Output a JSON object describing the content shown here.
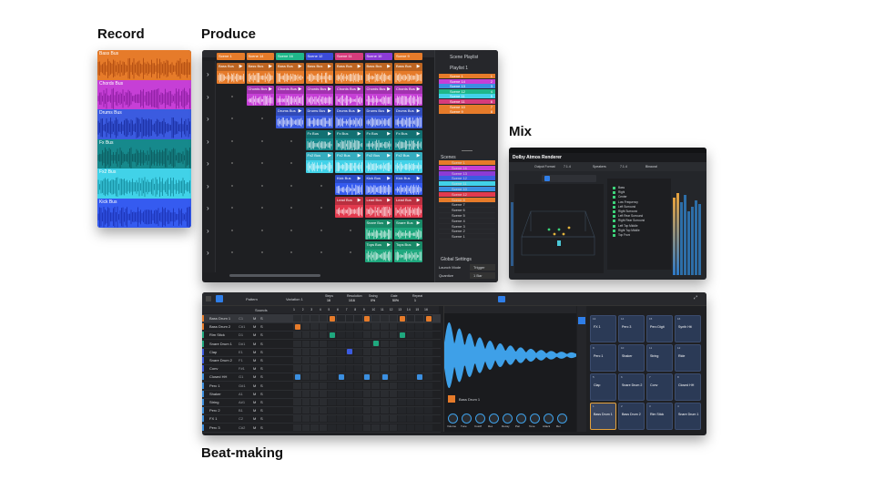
{
  "sections": {
    "record": "Record",
    "produce": "Produce",
    "mix": "Mix",
    "beat": "Beat-making"
  },
  "record": {
    "tracks": [
      {
        "name": "Bass Bus",
        "color": "#e67b2a",
        "wave": "#b24e12"
      },
      {
        "name": "Chords Bus",
        "color": "#c63fd6",
        "wave": "#8e1fa3"
      },
      {
        "name": "Drums Bus",
        "color": "#3b5be0",
        "wave": "#1b2fa2"
      },
      {
        "name": "Fx Bus",
        "color": "#16898c",
        "wave": "#0d5d60"
      },
      {
        "name": "Fx2 Bus",
        "color": "#41d2e8",
        "wave": "#178ea1"
      },
      {
        "name": "Kick Bus",
        "color": "#355bf0",
        "wave": "#1c34b6"
      }
    ]
  },
  "produce": {
    "scenes": [
      "Scene 1",
      "Scene 14",
      "Scene 16",
      "Scene 12",
      "Scene 11",
      "Scene 10",
      "Scene 9"
    ],
    "scene_colors": [
      "#e67b2a",
      "#e67b2a",
      "#1fb78a",
      "#3b4bd8",
      "#d63c7c",
      "#8c3bd6",
      "#e67b2a"
    ],
    "clips": [
      {
        "col": 0,
        "row": 0,
        "name": "Bass Bus",
        "color": "#e67b2a"
      },
      {
        "col": 1,
        "row": 0,
        "name": "Bass Bus",
        "color": "#e67b2a"
      },
      {
        "col": 2,
        "row": 0,
        "name": "Bass Bus",
        "color": "#e67b2a"
      },
      {
        "col": 3,
        "row": 0,
        "name": "Bass Bus",
        "color": "#e67b2a"
      },
      {
        "col": 4,
        "row": 0,
        "name": "Bass Bus",
        "color": "#e67b2a"
      },
      {
        "col": 5,
        "row": 0,
        "name": "Bass Bus",
        "color": "#e67b2a"
      },
      {
        "col": 6,
        "row": 0,
        "name": "Bass Bus",
        "color": "#e67b2a"
      },
      {
        "col": 1,
        "row": 1,
        "name": "Chords Bus",
        "color": "#c63fd6"
      },
      {
        "col": 2,
        "row": 1,
        "name": "Chords Bus",
        "color": "#c63fd6"
      },
      {
        "col": 3,
        "row": 1,
        "name": "Chords Bus",
        "color": "#c63fd6"
      },
      {
        "col": 4,
        "row": 1,
        "name": "Chords Bus",
        "color": "#c63fd6"
      },
      {
        "col": 5,
        "row": 1,
        "name": "Chords Bus",
        "color": "#c63fd6"
      },
      {
        "col": 6,
        "row": 1,
        "name": "Chords Bus",
        "color": "#c63fd6"
      },
      {
        "col": 2,
        "row": 2,
        "name": "Drums Bus",
        "color": "#3b5be0"
      },
      {
        "col": 3,
        "row": 2,
        "name": "Drums Bus",
        "color": "#3b5be0"
      },
      {
        "col": 4,
        "row": 2,
        "name": "Drums Bus",
        "color": "#3b5be0"
      },
      {
        "col": 5,
        "row": 2,
        "name": "Drums Bus",
        "color": "#3b5be0"
      },
      {
        "col": 6,
        "row": 2,
        "name": "Drums Bus",
        "color": "#3b5be0"
      },
      {
        "col": 3,
        "row": 3,
        "name": "Fx Bus",
        "color": "#16898c"
      },
      {
        "col": 4,
        "row": 3,
        "name": "Fx Bus",
        "color": "#16898c"
      },
      {
        "col": 5,
        "row": 3,
        "name": "Fx Bus",
        "color": "#16898c"
      },
      {
        "col": 6,
        "row": 3,
        "name": "Fx Bus",
        "color": "#16898c"
      },
      {
        "col": 3,
        "row": 4,
        "name": "Fx2 Bus",
        "color": "#41d2e8"
      },
      {
        "col": 4,
        "row": 4,
        "name": "Fx2 Bus",
        "color": "#41d2e8"
      },
      {
        "col": 5,
        "row": 4,
        "name": "Fx2 Bus",
        "color": "#41d2e8"
      },
      {
        "col": 6,
        "row": 4,
        "name": "Fx2 Bus",
        "color": "#41d2e8"
      },
      {
        "col": 4,
        "row": 5,
        "name": "Kick Bus",
        "color": "#355bf0"
      },
      {
        "col": 5,
        "row": 5,
        "name": "Kick Bus",
        "color": "#355bf0"
      },
      {
        "col": 6,
        "row": 5,
        "name": "Kick Bus",
        "color": "#355bf0"
      },
      {
        "col": 4,
        "row": 6,
        "name": "Lead Bus",
        "color": "#e23a4e"
      },
      {
        "col": 5,
        "row": 6,
        "name": "Lead Bus",
        "color": "#e23a4e"
      },
      {
        "col": 6,
        "row": 6,
        "name": "Lead Bus",
        "color": "#e23a4e"
      },
      {
        "col": 5,
        "row": 7,
        "name": "Snare Bus",
        "color": "#1fa87e"
      },
      {
        "col": 6,
        "row": 7,
        "name": "Snare Bus",
        "color": "#1fa87e"
      },
      {
        "col": 5,
        "row": 8,
        "name": "Tops Bus",
        "color": "#1fa87e"
      },
      {
        "col": 6,
        "row": 8,
        "name": "Tops Bus",
        "color": "#1fa87e"
      }
    ],
    "playlist_title": "Scene Playlist",
    "playlist_name": "Playlist 1",
    "playlist_items": [
      {
        "name": "Scene 1",
        "num": "1",
        "color": "#e67b2a"
      },
      {
        "name": "Scene 14",
        "num": "2",
        "color": "#c63fd6"
      },
      {
        "name": "Scene 13",
        "num": "3",
        "color": "#3b8fe0"
      },
      {
        "name": "Scene 12",
        "num": "4",
        "color": "#1fb78a"
      },
      {
        "name": "Scene 11",
        "num": "5",
        "color": "#41d2e8"
      },
      {
        "name": "Scene 11",
        "num": "6",
        "color": "#d63c7c"
      },
      {
        "name": "Scene 10",
        "num": "7",
        "color": "#e67b2a"
      },
      {
        "name": "Scene 9",
        "num": "8",
        "color": "#e67b2a"
      }
    ],
    "scenes_title": "Scenes",
    "scene_list": [
      {
        "name": "Scene 1",
        "color": "#e67b2a"
      },
      {
        "name": "Scene 16",
        "color": "#c63fd6"
      },
      {
        "name": "Scene 13",
        "color": "#8c3bd6"
      },
      {
        "name": "Scene 12",
        "color": "#3b5be0"
      },
      {
        "name": "Scene 11",
        "color": "#41d2e8"
      },
      {
        "name": "Scene 10",
        "color": "#3b8fe0"
      },
      {
        "name": "Scene 12",
        "color": "#e23a4e"
      },
      {
        "name": "Scene 8",
        "color": "#e67b2a"
      },
      {
        "name": "Scene 7",
        "color": ""
      },
      {
        "name": "Scene 6",
        "color": ""
      },
      {
        "name": "Scene 5",
        "color": ""
      },
      {
        "name": "Scene 4",
        "color": ""
      },
      {
        "name": "Scene 3",
        "color": ""
      },
      {
        "name": "Scene 2",
        "color": ""
      },
      {
        "name": "Scene 1",
        "color": ""
      }
    ],
    "global_settings": "Global Settings",
    "launch_mode_label": "Launch Mode",
    "launch_mode_value": "Trigger",
    "quantize_label": "Quantize",
    "quantize_value": "1 Bar"
  },
  "mix": {
    "brand": "Dolby Atmos Renderer",
    "tabs": [
      "Output Format",
      "7.1.4",
      "Speakers",
      "7.1.4",
      "Binaural"
    ],
    "object_rows": [
      "Bass",
      "Right",
      "Center",
      "Low Frequency",
      "Left Surround",
      "Right Surround",
      "Left Rear Surround",
      "Right Rear Surround",
      "Left Top Middle",
      "Right Top Middle",
      "Top Front"
    ]
  },
  "beat": {
    "pattern_label": "Pattern",
    "variation_label": "Variation 1",
    "params": [
      {
        "label": "Steps",
        "value": "16"
      },
      {
        "label": "Resolution",
        "value": "1/16"
      },
      {
        "label": "Swing",
        "value": "0%"
      },
      {
        "label": "Gate",
        "value": "50%"
      },
      {
        "label": "Repeat",
        "value": "1"
      }
    ],
    "sounds_label": "Sounds",
    "columns": [
      "1",
      "2",
      "3",
      "4",
      "5",
      "6",
      "7",
      "8",
      "9",
      "10",
      "11",
      "12",
      "13",
      "14",
      "15",
      "16"
    ],
    "rows": [
      {
        "name": "Bass Drum 1",
        "ch": "C1",
        "color": "#e67b2a"
      },
      {
        "name": "Bass Drum 2",
        "ch": "C#1",
        "color": "#e67b2a"
      },
      {
        "name": "Rim Stick",
        "ch": "D1",
        "color": "#1fa87e"
      },
      {
        "name": "Snare Drum 1",
        "ch": "D#1",
        "color": "#1fa87e"
      },
      {
        "name": "Clap",
        "ch": "E1",
        "color": "#3b5be0"
      },
      {
        "name": "Snare Drum 2",
        "ch": "F1",
        "color": "#3b5be0"
      },
      {
        "name": "Conv",
        "ch": "F#1",
        "color": "#3b5be0"
      },
      {
        "name": "Closed HH",
        "ch": "G1",
        "color": "#3b8fe0"
      },
      {
        "name": "Perc 1",
        "ch": "G#1",
        "color": "#3b8fe0"
      },
      {
        "name": "Shaker",
        "ch": "A1",
        "color": "#3b8fe0"
      },
      {
        "name": "String",
        "ch": "A#1",
        "color": "#3b8fe0"
      },
      {
        "name": "Perc 2",
        "ch": "B1",
        "color": "#3b8fe0"
      },
      {
        "name": "FX 1",
        "ch": "C2",
        "color": "#3b8fe0"
      },
      {
        "name": "Perc 3",
        "ch": "C#2",
        "color": "#3b8fe0"
      }
    ],
    "sample_name": "Bass Drum 1",
    "mute_label": "M",
    "solo_label": "S",
    "knobs": [
      "Volume",
      "Tune",
      "Cutoff",
      "Res",
      "Decay",
      "Pan",
      "Tone",
      "Attack",
      "Rel"
    ],
    "pads": [
      {
        "n": "13",
        "name": "FX 1"
      },
      {
        "n": "14",
        "name": "Perc 3"
      },
      {
        "n": "15",
        "name": "Perc Digit"
      },
      {
        "n": "16",
        "name": "Synth Hit"
      },
      {
        "n": "9",
        "name": "Perc 1"
      },
      {
        "n": "10",
        "name": "Shaker"
      },
      {
        "n": "11",
        "name": "String"
      },
      {
        "n": "12",
        "name": "Ride"
      },
      {
        "n": "5",
        "name": "Clap"
      },
      {
        "n": "6",
        "name": "Snare Drum 2"
      },
      {
        "n": "7",
        "name": "Conv"
      },
      {
        "n": "8",
        "name": "Closed HH"
      },
      {
        "n": "1",
        "name": "Bass Drum 1"
      },
      {
        "n": "2",
        "name": "Bass Drum 2"
      },
      {
        "n": "3",
        "name": "Rim Stick"
      },
      {
        "n": "4",
        "name": "Snare Drum 1"
      }
    ],
    "steps": [
      {
        "row": 0,
        "col": 4,
        "color": "#e67b2a"
      },
      {
        "row": 0,
        "col": 8,
        "color": "#e67b2a"
      },
      {
        "row": 0,
        "col": 12,
        "color": "#e67b2a"
      },
      {
        "row": 0,
        "col": 16,
        "color": "#e67b2a"
      },
      {
        "row": 1,
        "col": 0,
        "color": "#e67b2a"
      },
      {
        "row": 2,
        "col": 4,
        "color": "#1fa87e"
      },
      {
        "row": 2,
        "col": 12,
        "color": "#1fa87e"
      },
      {
        "row": 3,
        "col": 9,
        "color": "#1fa87e"
      },
      {
        "row": 4,
        "col": 6,
        "color": "#3b5be0"
      },
      {
        "row": 7,
        "col": 0,
        "color": "#3b8fe0"
      },
      {
        "row": 7,
        "col": 5,
        "color": "#3b8fe0"
      },
      {
        "row": 7,
        "col": 8,
        "color": "#3b8fe0"
      },
      {
        "row": 7,
        "col": 10,
        "color": "#3b8fe0"
      },
      {
        "row": 7,
        "col": 14,
        "color": "#3b8fe0"
      }
    ]
  }
}
